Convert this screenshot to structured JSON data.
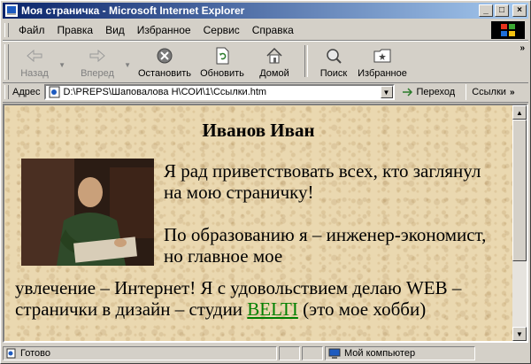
{
  "window": {
    "title": "Моя страничка - Microsoft Internet Explorer",
    "controls": {
      "minimize": "_",
      "maximize": "□",
      "close": "×"
    }
  },
  "menu": [
    "Файл",
    "Правка",
    "Вид",
    "Избранное",
    "Сервис",
    "Справка"
  ],
  "toolbar": {
    "back": "Назад",
    "forward": "Вперед",
    "stop": "Остановить",
    "refresh": "Обновить",
    "home": "Домой",
    "search": "Поиск",
    "favorites": "Избранное",
    "more": "»"
  },
  "address": {
    "label": "Адрес",
    "value": "D:\\PREPS\\Шаповалова Н\\СОИ\\1\\Ссылки.htm",
    "go": "Переход",
    "links": "Ссылки",
    "links_more": "»"
  },
  "page": {
    "heading": "Иванов Иван",
    "paragraph1": "Я рад приветствовать всех, кто заглянул на мою страничку!",
    "paragraph2": "По образованию я – инженер-экономист, но главное мое",
    "paragraph3_before": "увлечение – Интернет! Я с удовольствием делаю WEB – странички в дизайн – студии ",
    "link_text": "BELTI",
    "paragraph3_after": " (это мое хобби)",
    "link_color": "#008000"
  },
  "status": {
    "text": "Готово",
    "zone": "Мой компьютер"
  },
  "icons": {
    "back": "back-arrow-icon",
    "forward": "forward-arrow-icon",
    "stop": "stop-icon",
    "refresh": "refresh-icon",
    "home": "home-icon",
    "search": "search-icon",
    "favorites": "favorites-icon"
  }
}
